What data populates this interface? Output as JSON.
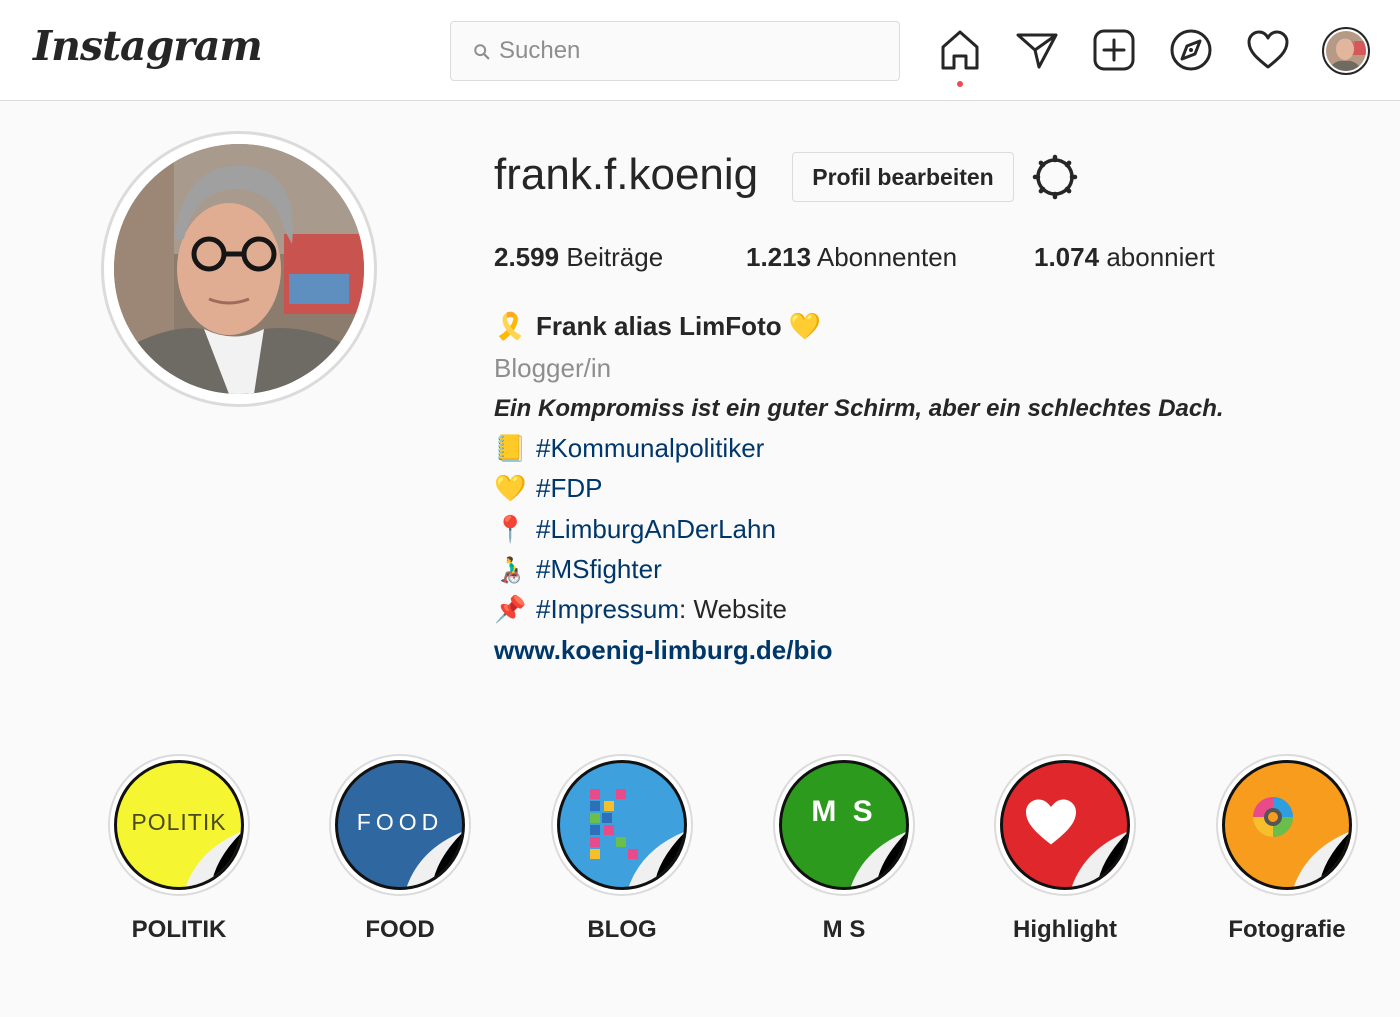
{
  "header": {
    "logo": "Instagram",
    "search_placeholder": "Suchen",
    "nav_icons": [
      "home-icon",
      "direct-icon",
      "new-post-icon",
      "explore-icon",
      "activity-heart-icon",
      "profile-avatar"
    ]
  },
  "profile": {
    "username": "frank.f.koenig",
    "edit_button": "Profil bearbeiten",
    "stats": {
      "posts_count": "2.599",
      "posts_label": "Beiträge",
      "followers_count": "1.213",
      "followers_label": "Abonnenten",
      "following_count": "1.074",
      "following_label": "abonniert"
    },
    "bio": {
      "full_name": "Frank alias LimFoto",
      "name_emoji_before": "🎗️",
      "name_emoji_after": "💛",
      "category": "Blogger/in",
      "quote": "Ein Kompromiss ist ein guter Schirm, aber ein schlechtes Dach.",
      "lines": [
        {
          "emoji": "📒",
          "text": "#Kommunalpolitiker"
        },
        {
          "emoji": "💛",
          "text": "#FDP"
        },
        {
          "emoji": "📍",
          "text": "#LimburgAnDerLahn"
        },
        {
          "emoji": "👨‍🦽",
          "text": "#MSfighter"
        },
        {
          "emoji": "📌",
          "text": "#Impressum",
          "suffix": ": Website"
        }
      ],
      "website": "www.koenig-limburg.de/bio"
    }
  },
  "highlights": [
    {
      "label": "POLITIK",
      "cover_text": "POLITIK",
      "color": "#f5f532",
      "text_color": "#4a4a1a"
    },
    {
      "label": "FOOD",
      "cover_text": "FOOD",
      "color": "#2f67a0",
      "text_color": "#ffffff"
    },
    {
      "label": "BLOG",
      "cover_text": "",
      "color": "#3ea0dc",
      "text_color": "#ffffff"
    },
    {
      "label": "M S",
      "cover_text": "M S",
      "color": "#2c9a1c",
      "text_color": "#ffffff"
    },
    {
      "label": "Highlight",
      "cover_text": "",
      "color": "#e0282c",
      "text_color": "#ffffff"
    },
    {
      "label": "Fotografie",
      "cover_text": "",
      "color": "#f79c1c",
      "text_color": "#ffffff"
    }
  ],
  "colors": {
    "link": "#00376b",
    "notification_dot": "#ed4956",
    "border": "#dbdbdb",
    "secondary_text": "#8e8e8e"
  }
}
